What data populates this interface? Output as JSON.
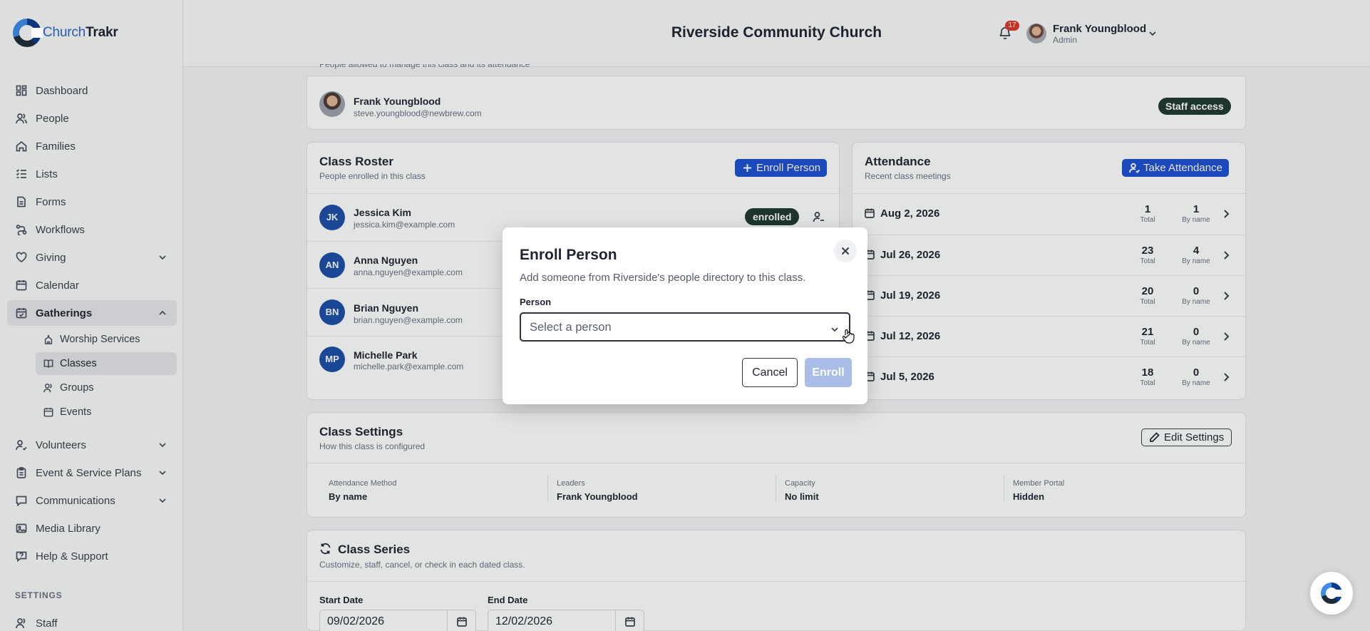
{
  "app": {
    "logo_part1": "Church",
    "logo_part2": "Trakr",
    "header_title": "Riverside Community Church",
    "notification_count": "17",
    "user_name": "Frank Youngblood",
    "user_role": "Admin"
  },
  "sidebar": {
    "items": [
      {
        "label": "Dashboard",
        "icon": "dashboard-icon"
      },
      {
        "label": "People",
        "icon": "people-icon"
      },
      {
        "label": "Families",
        "icon": "home-icon"
      },
      {
        "label": "Lists",
        "icon": "list-icon"
      },
      {
        "label": "Forms",
        "icon": "form-icon"
      },
      {
        "label": "Workflows",
        "icon": "workflow-icon"
      },
      {
        "label": "Giving",
        "icon": "heart-icon"
      },
      {
        "label": "Calendar",
        "icon": "calendar-icon"
      },
      {
        "label": "Gatherings",
        "icon": "calendar-check-icon"
      },
      {
        "label": "Volunteers",
        "icon": "volunteer-icon"
      },
      {
        "label": "Event & Service Plans",
        "icon": "clipboard-icon"
      },
      {
        "label": "Communications",
        "icon": "message-icon"
      },
      {
        "label": "Media Library",
        "icon": "media-icon"
      },
      {
        "label": "Help & Support",
        "icon": "help-icon"
      }
    ],
    "sub_items": [
      {
        "label": "Worship Services"
      },
      {
        "label": "Classes"
      },
      {
        "label": "Groups"
      },
      {
        "label": "Events"
      }
    ],
    "section_label": "SETTINGS",
    "staff_label": "Staff"
  },
  "staff_card": {
    "cut_text": "People allowed to manage this class and its attendance",
    "name": "Frank Youngblood",
    "email": "steve.youngblood@newbrew.com",
    "badge": "Staff access"
  },
  "roster": {
    "title": "Class Roster",
    "subtitle": "People enrolled in this class",
    "enroll_button": "Enroll Person",
    "rows": [
      {
        "initials": "JK",
        "name": "Jessica Kim",
        "email": "jessica.kim@example.com"
      },
      {
        "initials": "AN",
        "name": "Anna Nguyen",
        "email": "anna.nguyen@example.com"
      },
      {
        "initials": "BN",
        "name": "Brian Nguyen",
        "email": "brian.nguyen@example.com"
      },
      {
        "initials": "MP",
        "name": "Michelle Park",
        "email": "michelle.park@example.com"
      }
    ],
    "status_badge": "enrolled"
  },
  "attendance": {
    "title": "Attendance",
    "subtitle": "Recent class meetings",
    "button": "Take Attendance",
    "total_label": "Total",
    "byname_label": "By name",
    "rows": [
      {
        "date": "Aug 2, 2026",
        "total": "1",
        "by_name": "1"
      },
      {
        "date": "Jul 26, 2026",
        "total": "23",
        "by_name": "4"
      },
      {
        "date": "Jul 19, 2026",
        "total": "20",
        "by_name": "0"
      },
      {
        "date": "Jul 12, 2026",
        "total": "21",
        "by_name": "0"
      },
      {
        "date": "Jul 5, 2026",
        "total": "18",
        "by_name": "0"
      }
    ]
  },
  "settings": {
    "title": "Class Settings",
    "subtitle": "How this class is configured",
    "edit_button": "Edit Settings",
    "fields": [
      {
        "label": "Attendance Method",
        "value": "By name"
      },
      {
        "label": "Leaders",
        "value": "Frank Youngblood"
      },
      {
        "label": "Capacity",
        "value": "No limit"
      },
      {
        "label": "Member Portal",
        "value": "Hidden"
      }
    ]
  },
  "series": {
    "title": "Class Series",
    "subtitle": "Customize, staff, cancel, or check in each dated class.",
    "start_label": "Start Date",
    "start_value": "09/02/2026",
    "end_label": "End Date",
    "end_value": "12/02/2026"
  },
  "modal": {
    "title": "Enroll Person",
    "description": "Add someone from Riverside's people directory to this class.",
    "person_label": "Person",
    "select_placeholder": "Select a person",
    "cancel": "Cancel",
    "enroll": "Enroll"
  }
}
